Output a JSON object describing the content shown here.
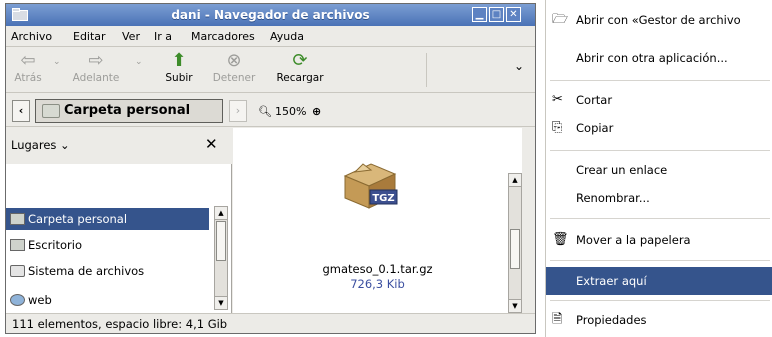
{
  "window": {
    "title": "dani - Navegador de archivos",
    "controls": [
      "minimize",
      "maximize",
      "close"
    ]
  },
  "menubar": [
    "Archivo",
    "Editar",
    "Ver",
    "Ir a",
    "Marcadores",
    "Ayuda"
  ],
  "toolbar": {
    "back": "Atrás",
    "forward": "Adelante",
    "up": "Subir",
    "stop": "Detener",
    "reload": "Recargar"
  },
  "location": {
    "path_button": "Carpeta personal",
    "zoom": "150%"
  },
  "sidebar": {
    "header": "Lugares",
    "items": [
      "Carpeta personal",
      "Escritorio",
      "Sistema de archivos",
      "web"
    ]
  },
  "file": {
    "name": "gmateso_0.1.tar.gz",
    "size": "726,3 Kib",
    "badge": "TGZ"
  },
  "statusbar": "111 elementos, espacio libre: 4,1 Gib",
  "context_menu": {
    "open_with_app": "Abrir con «Gestor de archivo",
    "open_with_other": "Abrir con otra aplicación...",
    "cut": "Cortar",
    "copy": "Copiar",
    "make_link": "Crear un enlace",
    "rename": "Renombrar...",
    "trash": "Mover a la papelera",
    "extract_here": "Extraer aquí",
    "properties": "Propiedades"
  },
  "colors": {
    "titlebar": "#4a72b6",
    "selection": "#35548c",
    "window_bg": "#ecebe7",
    "link_text": "#3b4fa0"
  }
}
